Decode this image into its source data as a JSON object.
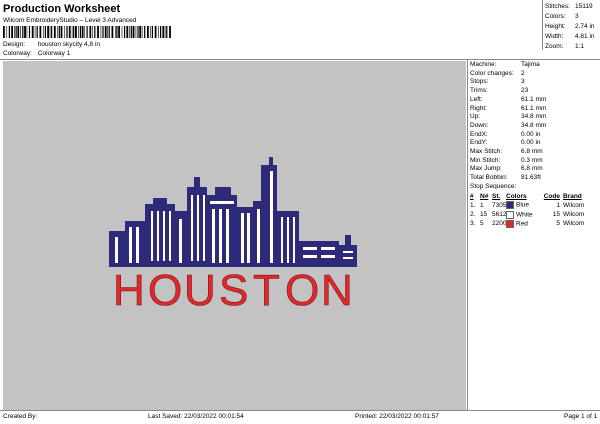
{
  "header": {
    "title": "Production Worksheet",
    "subtitle": "Wilcom EmbroideryStudio – Level 3 Advanced",
    "design_label": "Design:",
    "design_value": "houston skycity 4,8 in",
    "colorway_label": "Colorway:",
    "colorway_value": "Colorway 1"
  },
  "stats": [
    {
      "label": "Stitches:",
      "value": "15119"
    },
    {
      "label": "Colors:",
      "value": "3"
    },
    {
      "label": "Height:",
      "value": "2.74 in"
    },
    {
      "label": "Width:",
      "value": "4.81 in"
    },
    {
      "label": "Zoom:",
      "value": "1:1"
    }
  ],
  "info": [
    {
      "label": "Machine:",
      "value": "Tajima"
    },
    {
      "label": "Color changes:",
      "value": "2"
    },
    {
      "label": "Stops:",
      "value": "3"
    },
    {
      "label": "Trims:",
      "value": "23"
    },
    {
      "label": "Left:",
      "value": "61.1 mm"
    },
    {
      "label": "Right:",
      "value": "61.1 mm"
    },
    {
      "label": "Up:",
      "value": "34.8 mm"
    },
    {
      "label": "Down:",
      "value": "34.8 mm"
    },
    {
      "label": "EndX:",
      "value": "0.00 in"
    },
    {
      "label": "EndY:",
      "value": "0.00 in"
    },
    {
      "label": "Max Stitch:",
      "value": "6.8 mm"
    },
    {
      "label": "Min Stitch:",
      "value": "0.3 mm"
    },
    {
      "label": "Max Jump:",
      "value": "6.8 mm"
    },
    {
      "label": "Total Bobbin:",
      "value": "81.63ft"
    }
  ],
  "stop_sequence": {
    "title": "Stop Sequence:",
    "headers": [
      "#",
      "N#",
      "St.",
      "Colors",
      "Code",
      "Brand"
    ],
    "rows": [
      {
        "num": "1.",
        "n": "1",
        "st": "7305",
        "color_name": "Blue",
        "code": "1",
        "brand": "Wilcom",
        "swatch": "#2e2a7a"
      },
      {
        "num": "2.",
        "n": "15",
        "st": "5612",
        "color_name": "White",
        "code": "15",
        "brand": "Wilcom",
        "swatch": "#ffffff"
      },
      {
        "num": "3.",
        "n": "5",
        "st": "2200",
        "color_name": "Red",
        "code": "5",
        "brand": "Wilcom",
        "swatch": "#e0282e"
      }
    ]
  },
  "design": {
    "word": "HOUSTON",
    "letters": [
      "H",
      "O",
      "U",
      "S",
      "T",
      "O",
      "N"
    ],
    "text_color": "#e0282e",
    "skyline_color": "#2e2a7a",
    "background": "#c3c3c3"
  },
  "footer": {
    "created_by": "Created By:",
    "last_saved": "Last Saved: 22/03/2022 00:01:54",
    "printed": "Printed: 22/03/2022 00:01:57",
    "page": "Page 1 of 1"
  }
}
